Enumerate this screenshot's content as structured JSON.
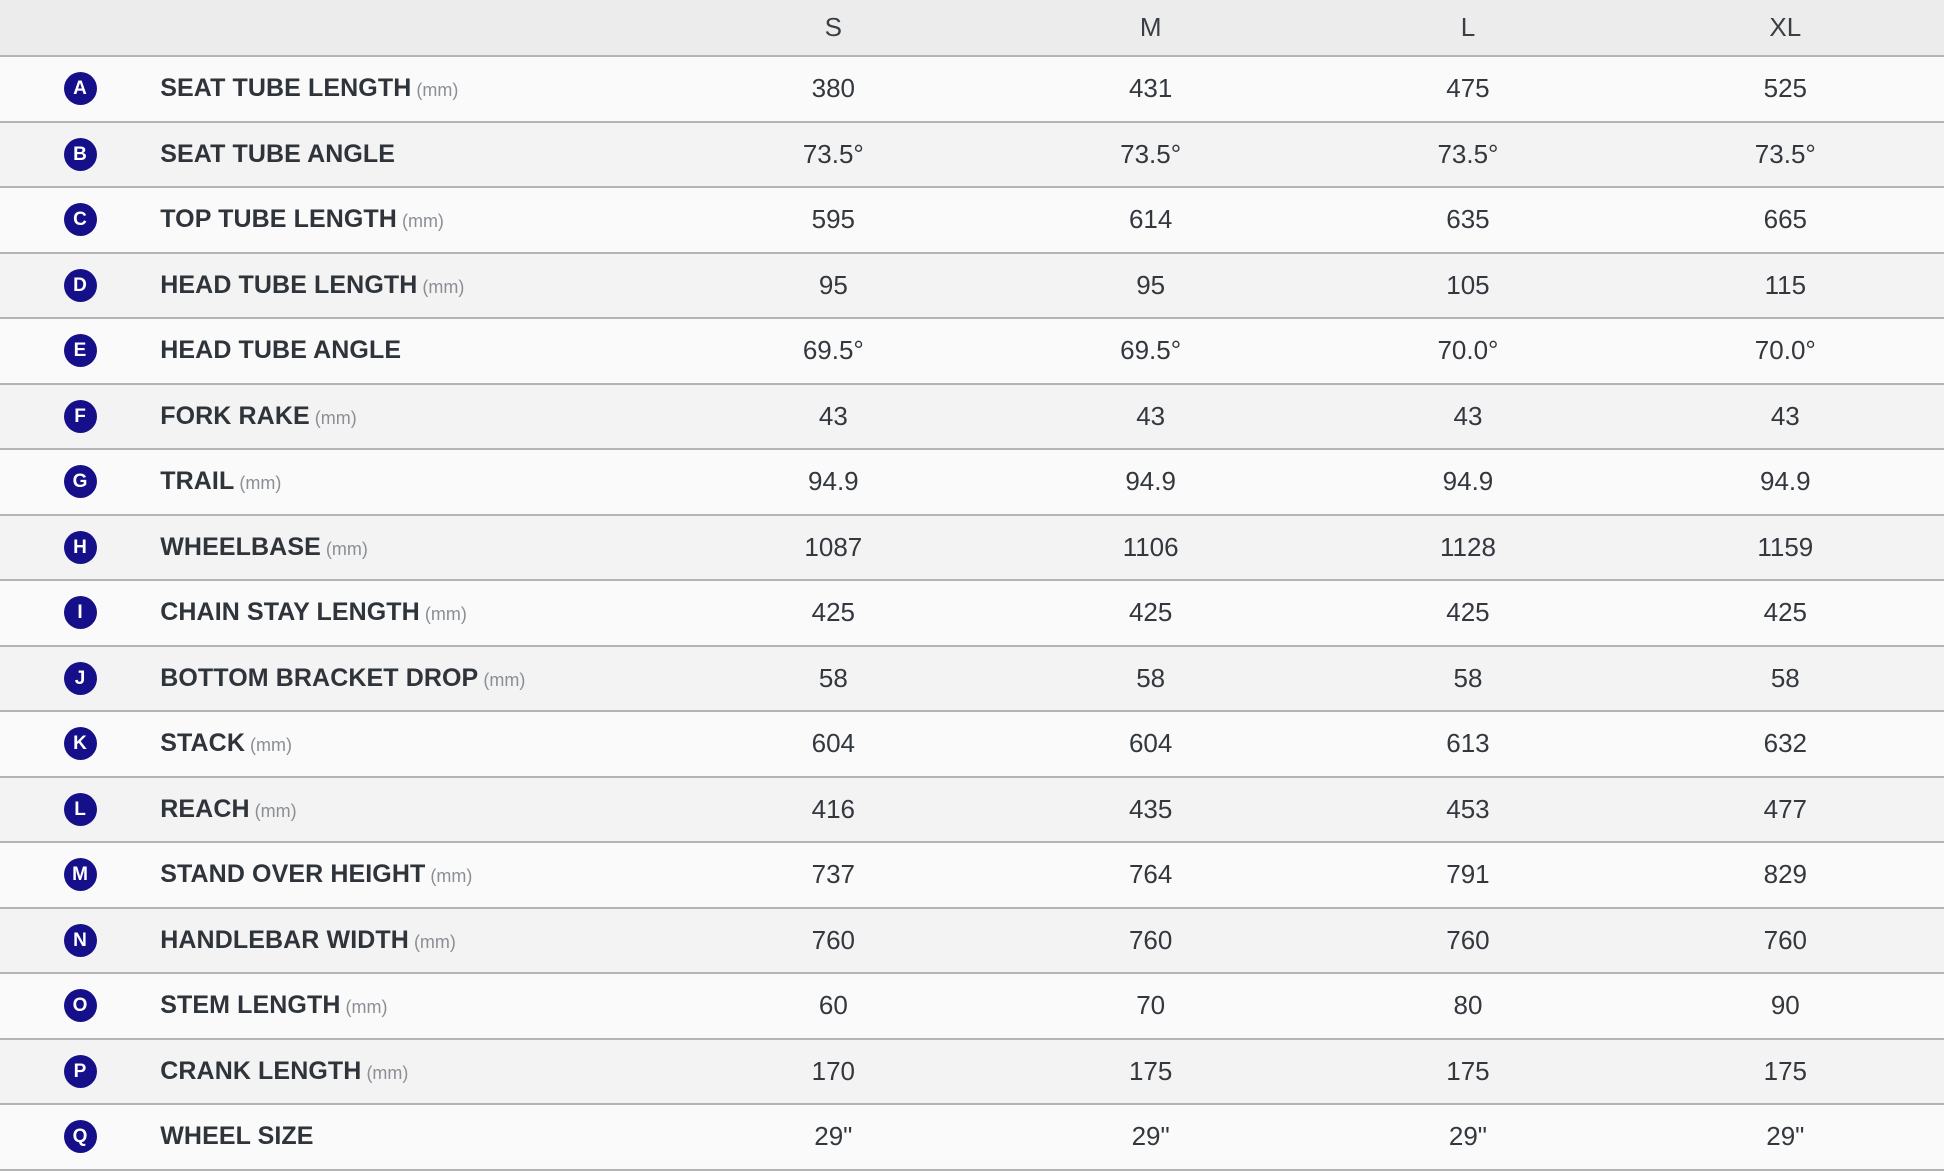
{
  "table": {
    "header": {
      "badge_col": "",
      "label_col": "",
      "sizes": [
        "S",
        "M",
        "L",
        "XL"
      ]
    },
    "accent_color": "#150f8a",
    "rows": [
      {
        "badge": "A",
        "label": "SEAT TUBE LENGTH",
        "unit": "(mm)",
        "values": [
          "380",
          "431",
          "475",
          "525"
        ]
      },
      {
        "badge": "B",
        "label": "SEAT TUBE ANGLE",
        "unit": "",
        "values": [
          "73.5°",
          "73.5°",
          "73.5°",
          "73.5°"
        ]
      },
      {
        "badge": "C",
        "label": "TOP TUBE LENGTH",
        "unit": "(mm)",
        "values": [
          "595",
          "614",
          "635",
          "665"
        ]
      },
      {
        "badge": "D",
        "label": "HEAD TUBE LENGTH",
        "unit": "(mm)",
        "values": [
          "95",
          "95",
          "105",
          "115"
        ]
      },
      {
        "badge": "E",
        "label": "HEAD TUBE ANGLE",
        "unit": "",
        "values": [
          "69.5°",
          "69.5°",
          "70.0°",
          "70.0°"
        ]
      },
      {
        "badge": "F",
        "label": "FORK RAKE",
        "unit": "(mm)",
        "values": [
          "43",
          "43",
          "43",
          "43"
        ]
      },
      {
        "badge": "G",
        "label": "TRAIL",
        "unit": "(mm)",
        "values": [
          "94.9",
          "94.9",
          "94.9",
          "94.9"
        ]
      },
      {
        "badge": "H",
        "label": "WHEELBASE",
        "unit": "(mm)",
        "values": [
          "1087",
          "1106",
          "1128",
          "1159"
        ]
      },
      {
        "badge": "I",
        "label": "CHAIN STAY LENGTH",
        "unit": "(mm)",
        "values": [
          "425",
          "425",
          "425",
          "425"
        ]
      },
      {
        "badge": "J",
        "label": "BOTTOM BRACKET DROP",
        "unit": "(mm)",
        "values": [
          "58",
          "58",
          "58",
          "58"
        ]
      },
      {
        "badge": "K",
        "label": "STACK",
        "unit": "(mm)",
        "values": [
          "604",
          "604",
          "613",
          "632"
        ]
      },
      {
        "badge": "L",
        "label": "REACH",
        "unit": "(mm)",
        "values": [
          "416",
          "435",
          "453",
          "477"
        ]
      },
      {
        "badge": "M",
        "label": "STAND OVER HEIGHT",
        "unit": "(mm)",
        "values": [
          "737",
          "764",
          "791",
          "829"
        ]
      },
      {
        "badge": "N",
        "label": "HANDLEBAR WIDTH",
        "unit": "(mm)",
        "values": [
          "760",
          "760",
          "760",
          "760"
        ]
      },
      {
        "badge": "O",
        "label": "STEM LENGTH",
        "unit": "(mm)",
        "values": [
          "60",
          "70",
          "80",
          "90"
        ]
      },
      {
        "badge": "P",
        "label": "CRANK LENGTH",
        "unit": "(mm)",
        "values": [
          "170",
          "175",
          "175",
          "175"
        ]
      },
      {
        "badge": "Q",
        "label": "WHEEL SIZE",
        "unit": "",
        "values": [
          "29\"",
          "29\"",
          "29\"",
          "29\""
        ]
      }
    ]
  }
}
